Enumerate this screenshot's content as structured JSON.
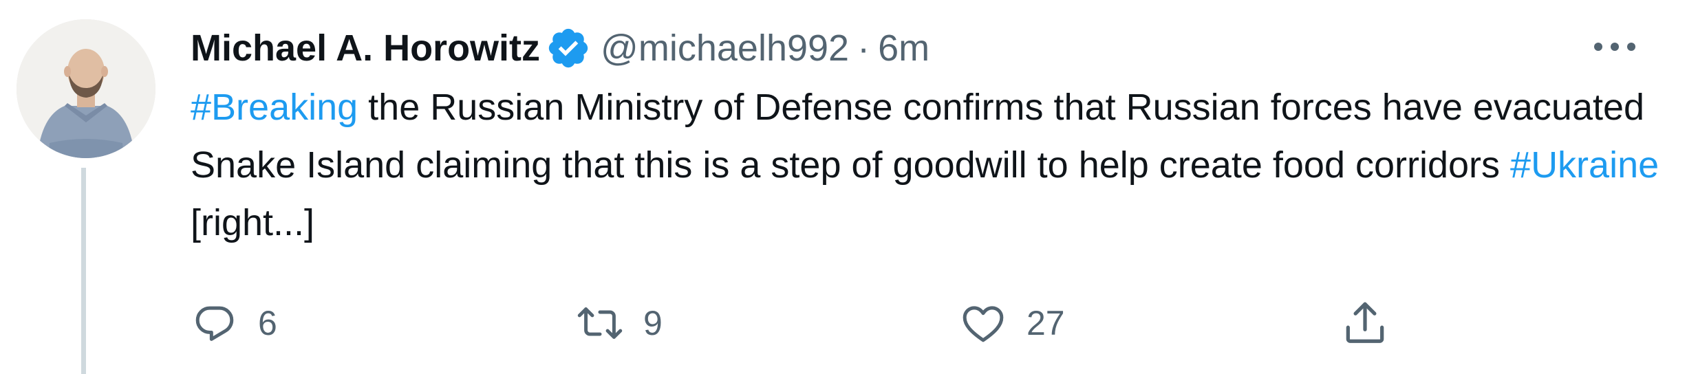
{
  "tweet": {
    "author": {
      "display_name": "Michael A. Horowitz",
      "verified": true,
      "handle": "@michaelh992",
      "separator": "·",
      "time": "6m"
    },
    "text_parts": {
      "hashtag1": "#Breaking",
      "body1": " the Russian Ministry of Defense confirms that Russian forces have evacuated Snake Island claiming that this is a step of goodwill to help create food corridors ",
      "hashtag2": "#Ukraine",
      "body2": " [right...]"
    },
    "actions": {
      "reply_count": "6",
      "retweet_count": "9",
      "like_count": "27"
    },
    "icons": {
      "more": "more-icon",
      "reply": "reply-icon",
      "retweet": "retweet-icon",
      "like": "heart-icon",
      "share": "share-icon",
      "verified": "verified-badge-icon"
    },
    "colors": {
      "link": "#1d9bf0",
      "secondary_text": "#536471",
      "primary_text": "#0f1419",
      "thread_line": "#cfd9de"
    }
  }
}
